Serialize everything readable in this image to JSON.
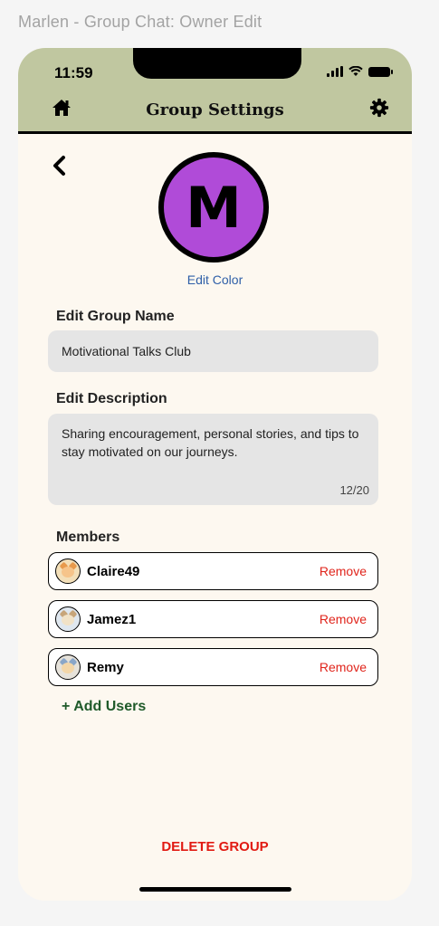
{
  "frame_label": "Marlen - Group Chat: Owner Edit",
  "status_bar": {
    "time": "11:59"
  },
  "header": {
    "title": "Group Settings",
    "home_icon": "home-icon",
    "settings_icon": "gear-icon",
    "bg_color": "#c0c7a0"
  },
  "group": {
    "avatar_letter": "M",
    "avatar_color": "#b04bd8",
    "edit_color_label": "Edit Color",
    "name_label": "Edit Group Name",
    "name_value": "Motivational Talks Club",
    "description_label": "Edit Description",
    "description_value": "Sharing encouragement, personal stories, and tips to stay motivated on our journeys.",
    "description_count": "12/20"
  },
  "members": {
    "label": "Members",
    "items": [
      {
        "name": "Claire49",
        "action": "Remove"
      },
      {
        "name": "Jamez1",
        "action": "Remove"
      },
      {
        "name": "Remy",
        "action": "Remove"
      }
    ],
    "add_label": "+ Add Users"
  },
  "delete_label": "DELETE GROUP"
}
